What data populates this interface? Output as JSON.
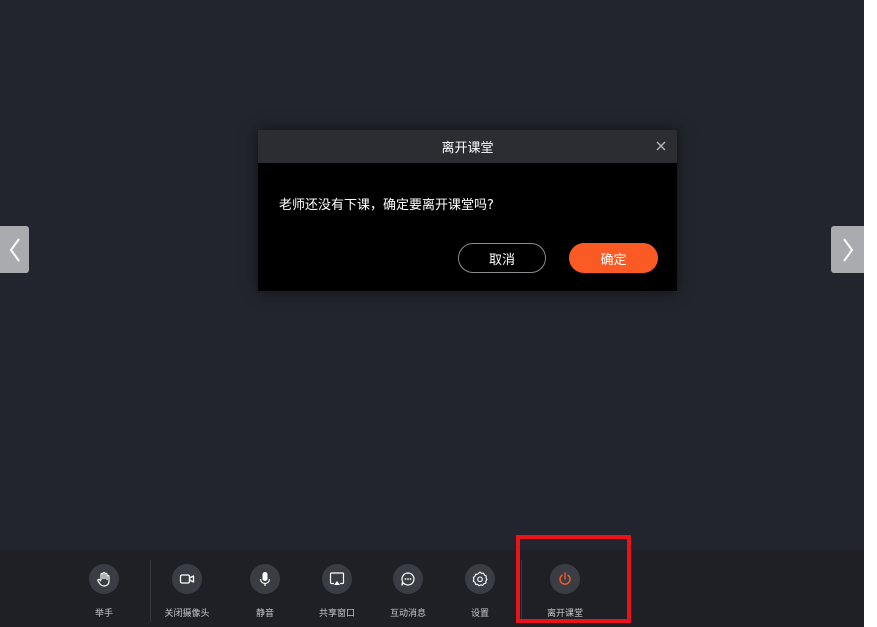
{
  "dialog": {
    "title": "离开课堂",
    "message": "老师还没有下课，确定要离开课堂吗?",
    "cancel_label": "取消",
    "confirm_label": "确定"
  },
  "toolbar": {
    "items": [
      {
        "label": "举手",
        "icon": "raise-hand-icon"
      },
      {
        "label": "关闭摄像头",
        "icon": "camera-icon"
      },
      {
        "label": "静音",
        "icon": "microphone-icon"
      },
      {
        "label": "共享窗口",
        "icon": "share-screen-icon"
      },
      {
        "label": "互动消息",
        "icon": "chat-icon"
      },
      {
        "label": "设置",
        "icon": "gear-icon"
      },
      {
        "label": "离开课堂",
        "icon": "power-icon"
      }
    ]
  },
  "colors": {
    "background": "#22252d",
    "toolbar": "#1e2025",
    "accent": "#fb5a24",
    "highlight": "#e8141a"
  }
}
